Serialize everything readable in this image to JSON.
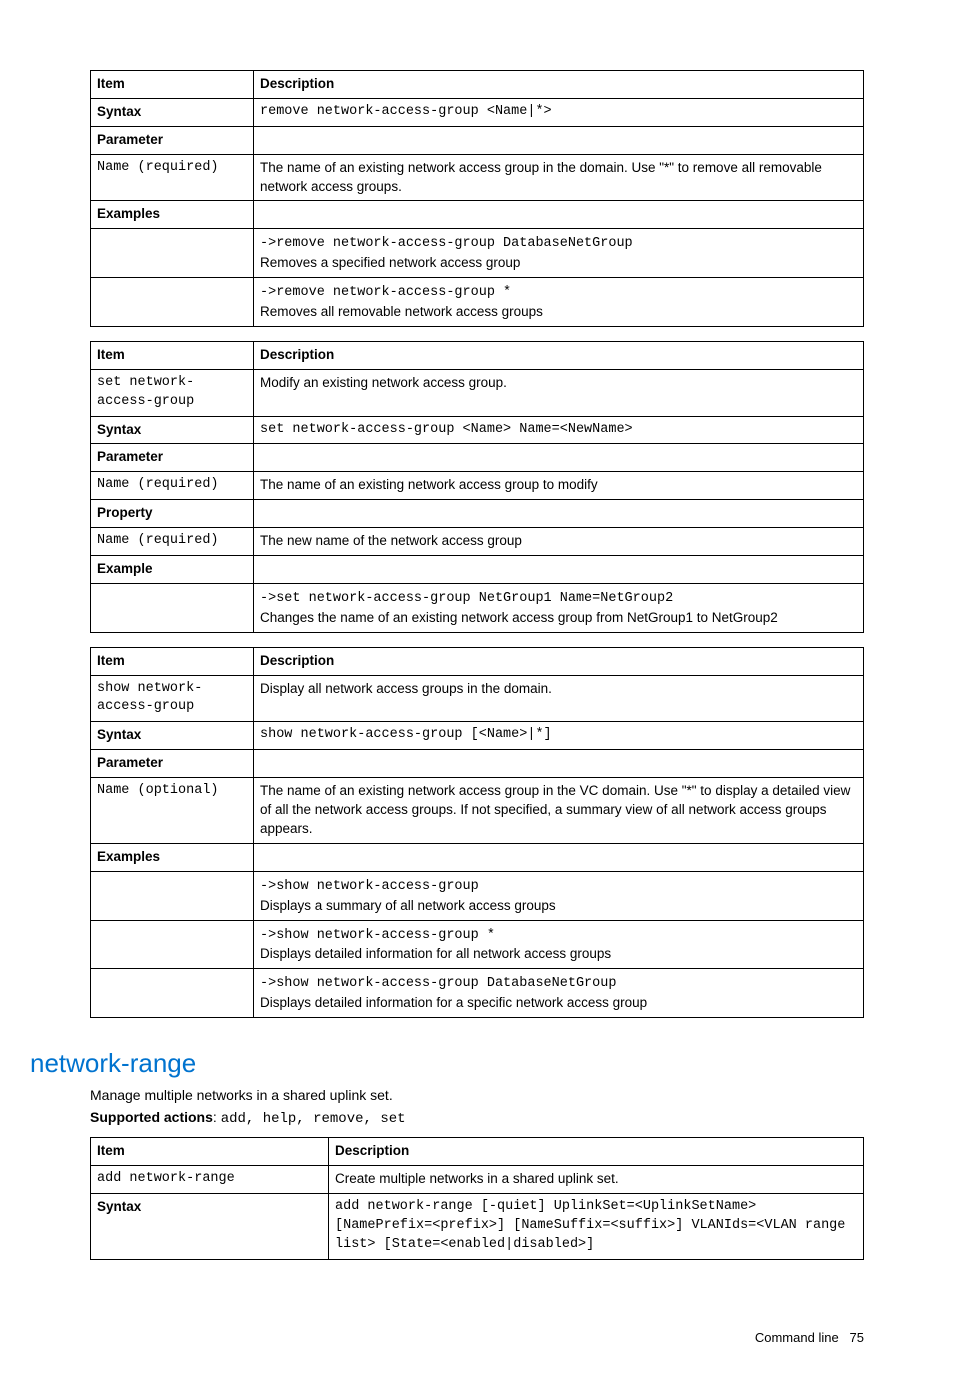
{
  "headers": {
    "item": "Item",
    "description": "Description"
  },
  "labels": {
    "syntax": "Syntax",
    "parameter": "Parameter",
    "examples": "Examples",
    "example": "Example",
    "property": "Property"
  },
  "table1": {
    "syntax_code": "remove network-access-group <Name|*>",
    "param_name": "Name (required)",
    "param_desc": "The name of an existing network access group in the domain. Use \"*\" to remove all removable network access groups.",
    "ex1_code": "->remove network-access-group DatabaseNetGroup",
    "ex1_desc": "Removes a specified network access group",
    "ex2_code": "->remove network-access-group *",
    "ex2_desc": "Removes all removable network access groups"
  },
  "table2": {
    "cmd_code": "set network-access-group",
    "cmd_desc": "Modify an existing network access group.",
    "syntax_code": "set network-access-group <Name> Name=<NewName>",
    "param_name": "Name (required)",
    "param_desc": "The name of an existing network access group to modify",
    "prop_name": "Name (required)",
    "prop_desc": "The new name of the network access group",
    "ex1_code": "->set network-access-group NetGroup1 Name=NetGroup2",
    "ex1_desc": "Changes the name of an existing network access group from NetGroup1 to NetGroup2"
  },
  "table3": {
    "cmd_code": "show network-access-group",
    "cmd_desc": "Display all network access groups in the domain.",
    "syntax_code": "show network-access-group [<Name>|*]",
    "param_name": "Name (optional)",
    "param_desc": "The name of an existing network access group in the VC domain. Use \"*\" to display a detailed view of all the network access groups. If not specified, a summary view of all network access groups appears.",
    "ex1_code": "->show network-access-group",
    "ex1_desc": "Displays a summary of all network access groups",
    "ex2_code": "->show network-access-group *",
    "ex2_desc": "Displays detailed information for all network access groups",
    "ex3_code": "->show network-access-group DatabaseNetGroup",
    "ex3_desc": "Displays detailed information for a specific network access group"
  },
  "section": {
    "title": "network-range",
    "intro": "Manage multiple networks in a shared uplink set.",
    "supported_label": "Supported actions",
    "supported_code": "add, help, remove, set"
  },
  "table4": {
    "cmd_code": "add network-range",
    "cmd_desc": "Create multiple networks in a shared uplink set.",
    "syntax_code": "add network-range [-quiet] UplinkSet=<UplinkSetName> [NamePrefix=<prefix>] [NameSuffix=<suffix>] VLANIds=<VLAN range list> [State=<enabled|disabled>]"
  },
  "footer": {
    "label": "Command line",
    "page": "75"
  }
}
